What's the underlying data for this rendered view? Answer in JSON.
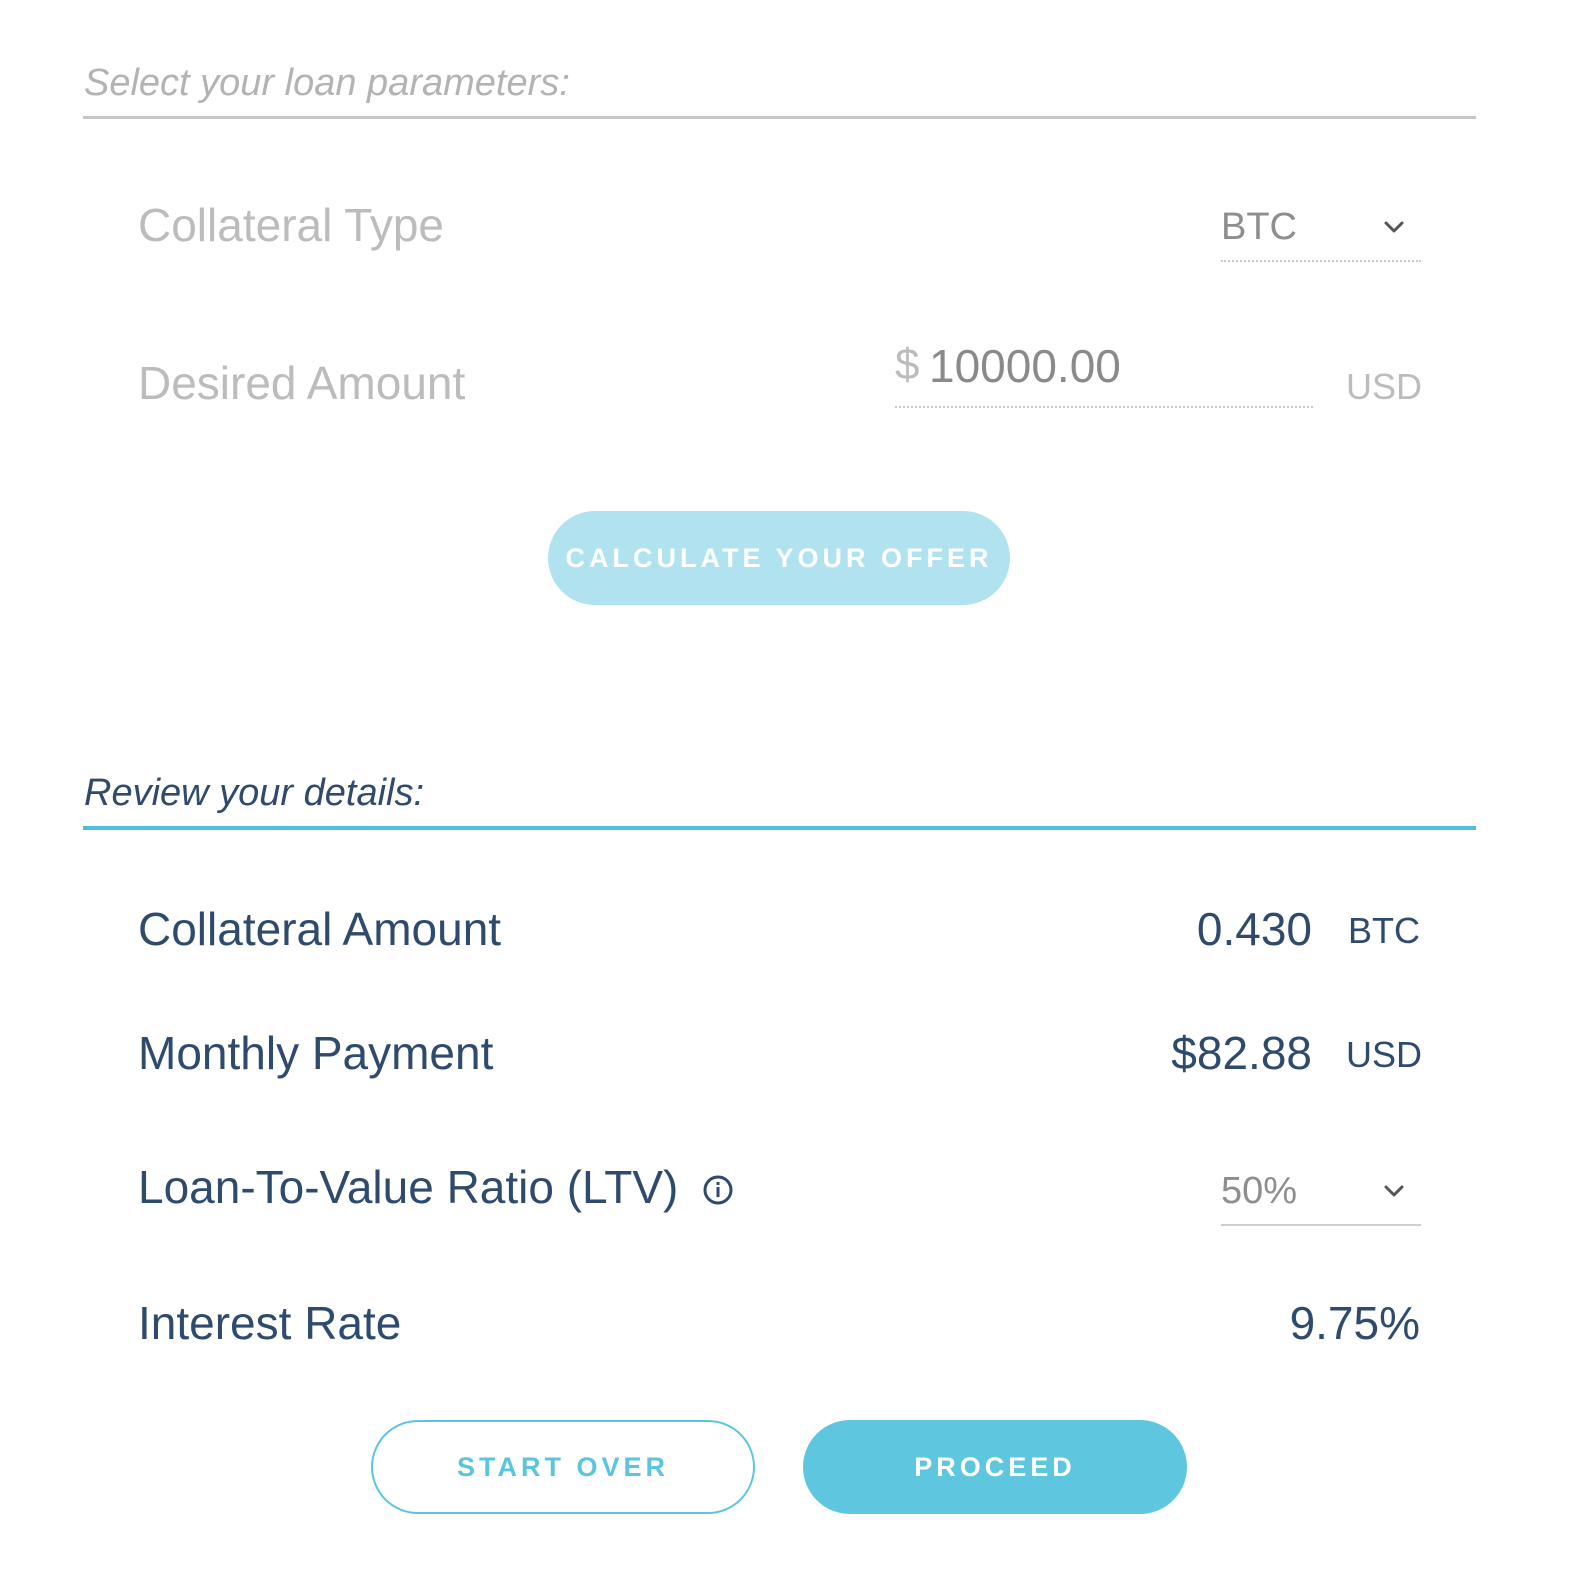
{
  "parameters": {
    "title": "Select your loan parameters:",
    "collateral_type": {
      "label": "Collateral Type",
      "selected": "BTC",
      "icon": "chevron-down-icon"
    },
    "desired_amount": {
      "label": "Desired Amount",
      "currency_symbol": "$",
      "value": "10000.00",
      "unit": "USD"
    },
    "calculate_button": "CALCULATE YOUR OFFER"
  },
  "review": {
    "title": "Review your details:",
    "collateral_amount": {
      "label": "Collateral Amount",
      "value": "0.430",
      "unit": "BTC"
    },
    "monthly_payment": {
      "label": "Monthly Payment",
      "value": "$82.88",
      "unit": "USD"
    },
    "ltv": {
      "label": "Loan-To-Value Ratio (LTV)",
      "info_icon": "info-icon",
      "selected": "50%",
      "icon": "chevron-down-icon"
    },
    "interest_rate": {
      "label": "Interest Rate",
      "value": "9.75%"
    }
  },
  "actions": {
    "start_over": "START OVER",
    "proceed": "PROCEED"
  },
  "colors": {
    "accent": "#5fc6e0",
    "accent_light": "#b0e3ef",
    "text_dark": "#2e4b6e",
    "text_muted": "#bcbcbc"
  }
}
